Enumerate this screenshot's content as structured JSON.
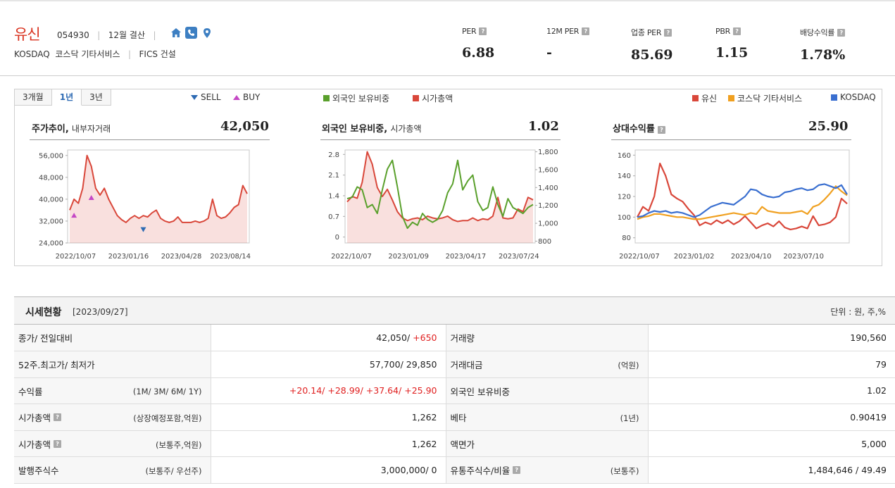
{
  "company": {
    "name": "유신",
    "code": "054930",
    "fiscal": "12월 결산",
    "market": "KOSDAQ",
    "sector": "코스닥 기타서비스",
    "fics": "FICS 건설",
    "icons": [
      "home-icon",
      "phone-icon",
      "location-pin-icon"
    ]
  },
  "metrics": [
    {
      "label": "PER",
      "value": "6.88"
    },
    {
      "label": "12M PER",
      "value": "-"
    },
    {
      "label": "업종 PER",
      "value": "85.69"
    },
    {
      "label": "PBR",
      "value": "1.15"
    },
    {
      "label": "배당수익률",
      "value": "1.78%"
    }
  ],
  "help_glyph": "?",
  "tabs": [
    "3개월",
    "1년",
    "3년"
  ],
  "active_tab": "1년",
  "legend_trade": {
    "sell": "SELL",
    "buy": "BUY"
  },
  "legend_foreign": {
    "foreign": "외국인 보유비중",
    "mcap": "시가총액"
  },
  "legend_relative": {
    "stock": "유신",
    "sector": "코스닥 기타서비스",
    "index": "KOSDAQ"
  },
  "colors": {
    "red": "#d9473a",
    "green": "#5aa02c",
    "orange": "#f0a020",
    "blue": "#3a6fd0",
    "sell": "#2d6ab3",
    "buy": "#c548c5"
  },
  "charts": {
    "price": {
      "title": "주가추이,",
      "subtitle": "내부자거래",
      "value": "42,050"
    },
    "foreign": {
      "title": "외국인 보유비중,",
      "subtitle": "시가총액",
      "value": "1.02"
    },
    "relative": {
      "title": "상대수익률",
      "value": "25.90"
    }
  },
  "chart_data": [
    {
      "type": "area",
      "title": "주가추이,",
      "ylim": [
        24000,
        58000
      ],
      "yticks": [
        "56,000",
        "48,000",
        "40,000",
        "32,000",
        "24,000"
      ],
      "ytick_values": [
        56000,
        48000,
        40000,
        32000,
        24000
      ],
      "xticks": [
        "2022/10/07",
        "2023/01/16",
        "2023/04/28",
        "2023/08/14"
      ],
      "series": [
        {
          "values": [
            36000,
            40000,
            38500,
            44000,
            56000,
            52000,
            44000,
            41500,
            44000,
            40000,
            37000,
            34000,
            32500,
            31500,
            33000,
            34000,
            33000,
            34000,
            33500,
            35000,
            36000,
            33000,
            32000,
            31500,
            32000,
            33500,
            31500,
            31500,
            31500,
            32000,
            31500,
            32000,
            33000,
            40000,
            34000,
            33000,
            33500,
            35000,
            37000,
            38000,
            45000,
            42000
          ]
        }
      ],
      "markers": [
        {
          "kind": "BUY",
          "index": 1,
          "value": 34000
        },
        {
          "kind": "BUY",
          "index": 5,
          "value": 40500
        },
        {
          "kind": "SELL",
          "index": 17,
          "value": 29000
        }
      ]
    },
    {
      "type": "line",
      "title": "외국인 보유비중,",
      "ylim_left": [
        -0.2,
        2.95
      ],
      "ylim_right": [
        780,
        1820
      ],
      "yticks_left": [
        "2.8",
        "2.1",
        "1.4",
        "0.7",
        "0"
      ],
      "ytick_values_left": [
        2.8,
        2.1,
        1.4,
        0.7,
        0
      ],
      "yticks_right": [
        "1,800",
        "1,600",
        "1,400",
        "1,200",
        "1,000",
        "800"
      ],
      "ytick_values_right": [
        1800,
        1600,
        1400,
        1200,
        1000,
        800
      ],
      "xticks": [
        "2022/10/07",
        "2023/01/09",
        "2023/04/17",
        "2023/07/24"
      ],
      "series": [
        {
          "name": "외국인 보유비중",
          "axis": "left",
          "values": [
            1.3,
            1.35,
            1.7,
            1.6,
            1.0,
            1.1,
            0.8,
            1.6,
            2.3,
            2.6,
            1.7,
            0.7,
            0.3,
            0.5,
            0.4,
            0.8,
            0.6,
            0.5,
            0.6,
            0.9,
            1.5,
            1.8,
            2.6,
            1.6,
            1.9,
            2.1,
            1.2,
            0.9,
            1.0,
            1.7,
            1.1,
            0.7,
            1.3,
            1.0,
            0.9,
            0.8,
            1.0,
            1.1
          ]
        },
        {
          "name": "시가총액",
          "axis": "right",
          "values": [
            1240,
            1300,
            1280,
            1460,
            1800,
            1660,
            1400,
            1300,
            1380,
            1260,
            1130,
            1060,
            1030,
            1050,
            1060,
            1040,
            1080,
            1060,
            1050,
            1060,
            1080,
            1040,
            1020,
            1030,
            1030,
            1060,
            1030,
            1050,
            1040,
            1080,
            1290,
            1060,
            1050,
            1060,
            1160,
            1130,
            1290,
            1262
          ]
        }
      ]
    },
    {
      "type": "line",
      "title": "상대수익률",
      "ylim": [
        75,
        165
      ],
      "yticks": [
        "160",
        "140",
        "120",
        "100",
        "80"
      ],
      "ytick_values": [
        160,
        140,
        120,
        100,
        80
      ],
      "xticks": [
        "2022/10/07",
        "2023/01/02",
        "2023/04/10",
        "2023/07/10"
      ],
      "series": [
        {
          "name": "유신",
          "values": [
            100,
            110,
            106,
            120,
            152,
            140,
            122,
            118,
            115,
            108,
            102,
            92,
            95,
            93,
            97,
            94,
            97,
            93,
            96,
            101,
            95,
            89,
            92,
            94,
            91,
            96,
            90,
            88,
            89,
            91,
            89,
            101,
            92,
            93,
            95,
            100,
            118,
            113
          ]
        },
        {
          "name": "코스닥 기타서비스",
          "values": [
            98,
            100,
            101,
            103,
            103,
            102,
            101,
            100,
            100,
            99,
            98,
            98,
            99,
            100,
            101,
            102,
            103,
            104,
            103,
            102,
            104,
            103,
            110,
            106,
            105,
            104,
            104,
            104,
            105,
            106,
            103,
            110,
            112,
            117,
            123,
            130,
            125,
            121
          ]
        },
        {
          "name": "KOSDAQ",
          "values": [
            100,
            101,
            104,
            106,
            105,
            106,
            104,
            105,
            104,
            102,
            100,
            102,
            106,
            110,
            112,
            114,
            113,
            112,
            116,
            120,
            127,
            126,
            122,
            120,
            119,
            120,
            124,
            125,
            127,
            128,
            126,
            127,
            131,
            132,
            130,
            128,
            131,
            122
          ]
        }
      ]
    }
  ],
  "table": {
    "title": "시세현황",
    "date": "[2023/09/27]",
    "unit": "단위 : 원, 주,%",
    "rows": [
      {
        "label": "종가/ 전일대비",
        "note": "",
        "help": false,
        "value_plain": "42,050/ ",
        "value_red": "+650",
        "label2": "거래량",
        "note2": "",
        "help2": false,
        "value2": "190,560"
      },
      {
        "label": "52주.최고가/ 최저가",
        "note": "",
        "help": false,
        "value_plain": "57,700/ 29,850",
        "value_red": "",
        "label2": "거래대금",
        "note2": "(억원)",
        "help2": false,
        "value2": "79"
      },
      {
        "label": "수익률",
        "note": "(1M/ 3M/ 6M/ 1Y)",
        "help": false,
        "value_plain": "",
        "value_red": "+20.14/ +28.99/ +37.64/ +25.90",
        "label2": "외국인 보유비중",
        "note2": "",
        "help2": false,
        "value2": "1.02"
      },
      {
        "label": "시가총액",
        "note": "(상장예정포함,억원)",
        "help": true,
        "value_plain": "1,262",
        "value_red": "",
        "label2": "베타",
        "note2": "(1년)",
        "help2": false,
        "value2": "0.90419"
      },
      {
        "label": "시가총액",
        "note": "(보통주,억원)",
        "help": true,
        "value_plain": "1,262",
        "value_red": "",
        "label2": "액면가",
        "note2": "",
        "help2": false,
        "value2": "5,000"
      },
      {
        "label": "발행주식수",
        "note": "(보통주/ 우선주)",
        "help": false,
        "value_plain": "3,000,000/ 0",
        "value_red": "",
        "label2": "유통주식수/비율",
        "note2": "(보통주)",
        "help2": true,
        "value2": "1,484,646 / 49.49"
      }
    ]
  }
}
